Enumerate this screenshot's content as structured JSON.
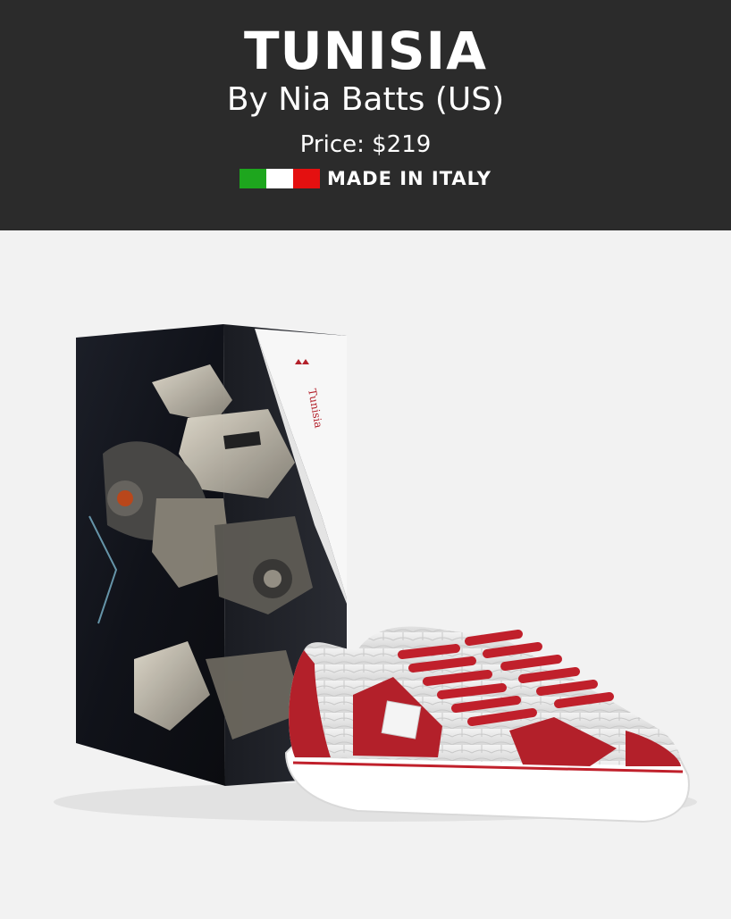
{
  "product": {
    "title": "TUNISIA",
    "byline": "By Nia Batts (US)",
    "price": "Price: $219",
    "made_in": "MADE IN ITALY"
  },
  "flag_colors": {
    "green": "#1ea61e",
    "white": "#ffffff",
    "red": "#e41010"
  },
  "colors": {
    "header_bg": "#2b2b2b",
    "page_bg": "#f2f2f2",
    "accent_red": "#b3202a"
  }
}
